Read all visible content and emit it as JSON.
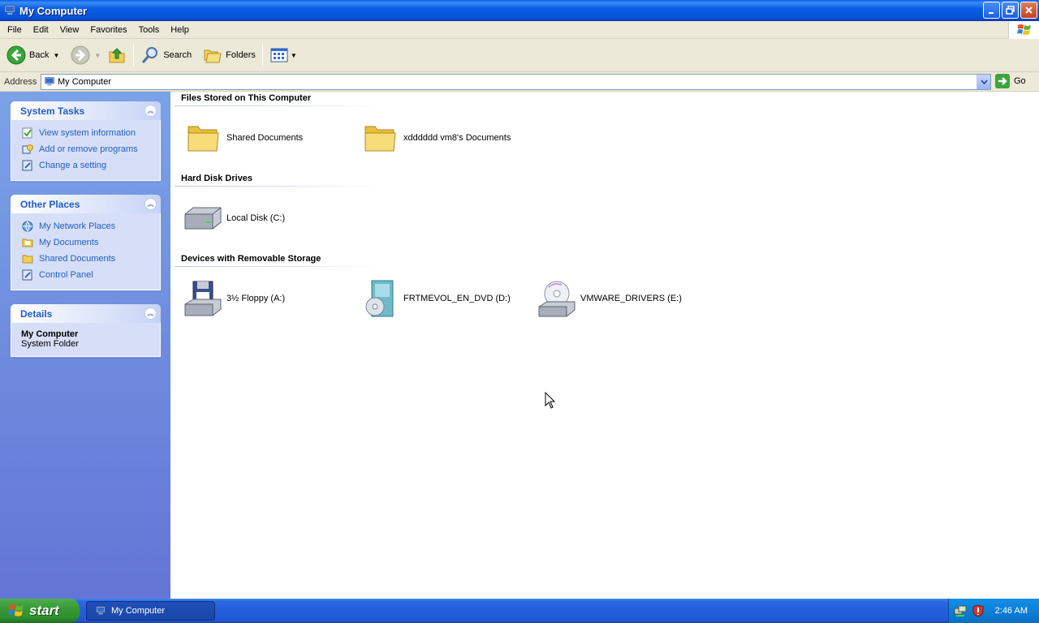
{
  "window": {
    "title": "My Computer"
  },
  "menubar": {
    "items": [
      "File",
      "Edit",
      "View",
      "Favorites",
      "Tools",
      "Help"
    ]
  },
  "toolbar": {
    "back_label": "Back",
    "search_label": "Search",
    "folders_label": "Folders"
  },
  "addressbar": {
    "label": "Address",
    "value": "My Computer",
    "go_label": "Go"
  },
  "leftpane": {
    "system_tasks": {
      "title": "System Tasks",
      "items": [
        "View system information",
        "Add or remove programs",
        "Change a setting"
      ]
    },
    "other_places": {
      "title": "Other Places",
      "items": [
        "My Network Places",
        "My Documents",
        "Shared Documents",
        "Control Panel"
      ]
    },
    "details": {
      "title": "Details",
      "name": "My Computer",
      "desc": "System Folder"
    }
  },
  "main": {
    "groups": [
      {
        "title": "Files Stored on This Computer",
        "items": [
          "Shared Documents",
          "xdddddd vm8's Documents"
        ]
      },
      {
        "title": "Hard Disk Drives",
        "items": [
          "Local Disk (C:)"
        ]
      },
      {
        "title": "Devices with Removable Storage",
        "items": [
          "3½ Floppy (A:)",
          "FRTMEVOL_EN_DVD (D:)",
          "VMWARE_DRIVERS (E:)"
        ]
      }
    ]
  },
  "taskbar": {
    "start_label": "start",
    "task_label": "My Computer",
    "clock": "2:46 AM"
  },
  "colors": {
    "titlebar": "#0a5ee6",
    "leftpane": "#7ba2e7",
    "link": "#215dc6",
    "taskbar": "#245edb",
    "start": "#379a37"
  }
}
